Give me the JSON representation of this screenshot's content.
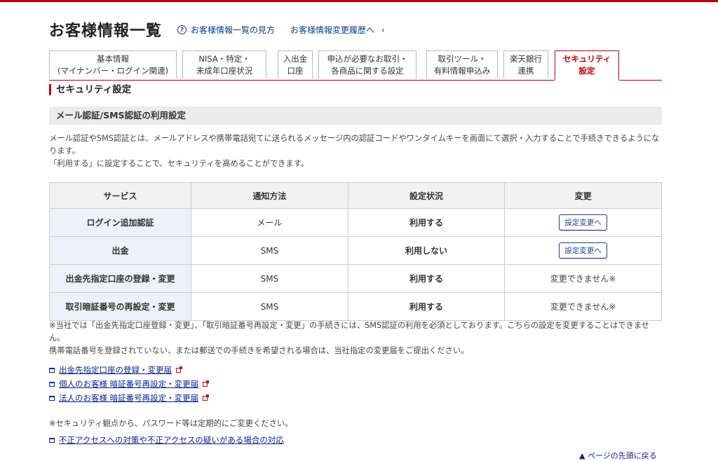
{
  "header": {
    "title": "お客様情報一覧",
    "help_link": "お客様情報一覧の見方",
    "history_link": "お客様情報変更履歴へ"
  },
  "tabs": [
    {
      "line1": "基本情報",
      "line2": "(マイナンバー・ログイン関連)"
    },
    {
      "line1": "NISA・特定・",
      "line2": "未成年口座状況"
    },
    {
      "line1": "入出金",
      "line2": "口座"
    },
    {
      "line1": "申込が必要なお取引・",
      "line2": "各商品に関する設定"
    },
    {
      "line1": "取引ツール・",
      "line2": "有料情報申込み"
    },
    {
      "line1": "楽天銀行",
      "line2": "連携"
    },
    {
      "line1": "セキュリティ",
      "line2": "設定",
      "active": true
    }
  ],
  "section_title": "セキュリティ設定",
  "sub_title": "メール認証/SMS認証の利用設定",
  "description": {
    "line1": "メール認証やSMS認証とは、メールアドレスや携帯電話宛てに送られるメッセージ内の認証コードやワンタイムキーを画面にて選択・入力することで手続きできるようになります。",
    "line2": "「利用する」に設定することで、セキュリティを高めることができます。"
  },
  "table": {
    "headers": [
      "サービス",
      "通知方法",
      "設定状況",
      "変更"
    ],
    "rows": [
      {
        "service": "ログイン追加認証",
        "method": "メール",
        "status": "利用する",
        "change": "設定変更へ",
        "change_is_button": true
      },
      {
        "service": "出金",
        "method": "SMS",
        "status": "利用しない",
        "change": "設定変更へ",
        "change_is_button": true
      },
      {
        "service": "出金先指定口座の登録・変更",
        "method": "SMS",
        "status": "利用する",
        "change": "変更できません※",
        "change_is_button": false
      },
      {
        "service": "取引暗証番号の再設定・変更",
        "method": "SMS",
        "status": "利用する",
        "change": "変更できません※",
        "change_is_button": false
      }
    ]
  },
  "notes": {
    "line1": "※当社では「出金先指定口座登録・変更」、「取引暗証番号再設定・変更」の手続きには、SMS認証の利用を必須としております。こちらの設定を変更することはできません。",
    "line2": "携帯電話番号を登録されていない、または郵送での手続きを希望される場合は、当社指定の変更届をご提出ください。"
  },
  "doc_links": [
    "出金先指定口座の登録・変更届",
    "個人のお客様 暗証番号再設定・変更届",
    "法人のお客様 暗証番号再設定・変更届"
  ],
  "security_note": "※セキュリティ観点から、パスワード等は定期的にご変更ください。",
  "fraud_link": "不正アクセスへの対策や不正アクセスの疑いがある場合の対応",
  "back_to_top": "ページの先頭に戻る",
  "colors": {
    "accent": "#bf0000",
    "link": "#0b1f8f"
  }
}
